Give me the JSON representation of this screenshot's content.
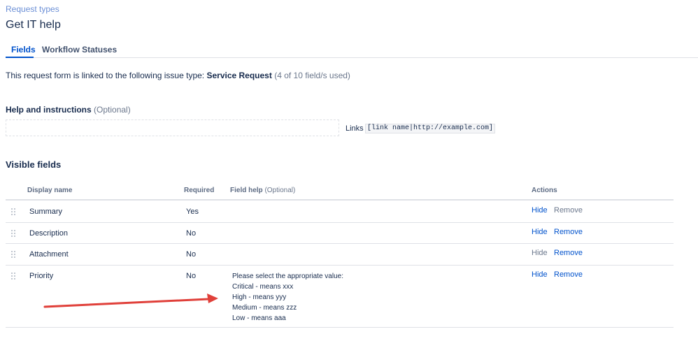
{
  "breadcrumb": "Request types",
  "page_title": "Get IT help",
  "tabs": [
    {
      "label": "Fields",
      "active": true
    },
    {
      "label": "Workflow Statuses",
      "active": false
    }
  ],
  "linked_info": {
    "prefix": "This request form is linked to the following issue type: ",
    "issue_type": "Service Request",
    "usage": " (4 of 10 field/s used)"
  },
  "help_section": {
    "title": "Help and instructions",
    "optional": " (Optional)",
    "input_value": "",
    "links_label": "Links",
    "links_example": "[link name|http://example.com]"
  },
  "visible_fields": {
    "title": "Visible fields",
    "columns": {
      "display_name": "Display name",
      "required": "Required",
      "field_help": "Field help",
      "field_help_optional": " (Optional)",
      "actions": "Actions"
    },
    "rows": [
      {
        "name": "Summary",
        "required": "Yes",
        "help": [],
        "hide": "Hide",
        "remove": "Remove"
      },
      {
        "name": "Description",
        "required": "No",
        "help": [],
        "hide": "Hide",
        "remove": "Remove"
      },
      {
        "name": "Attachment",
        "required": "No",
        "help": [],
        "hide": "Hide",
        "remove": "Remove"
      },
      {
        "name": "Priority",
        "required": "No",
        "help": [
          "Please select the appropriate value:",
          "Critical - means xxx",
          "High - means yyy",
          "Medium - means zzz",
          "Low - means aaa"
        ],
        "hide": "Hide",
        "remove": "Remove"
      }
    ]
  },
  "colors": {
    "link": "#0052cc",
    "muted": "#6b778c",
    "arrow": "#e0403a"
  }
}
